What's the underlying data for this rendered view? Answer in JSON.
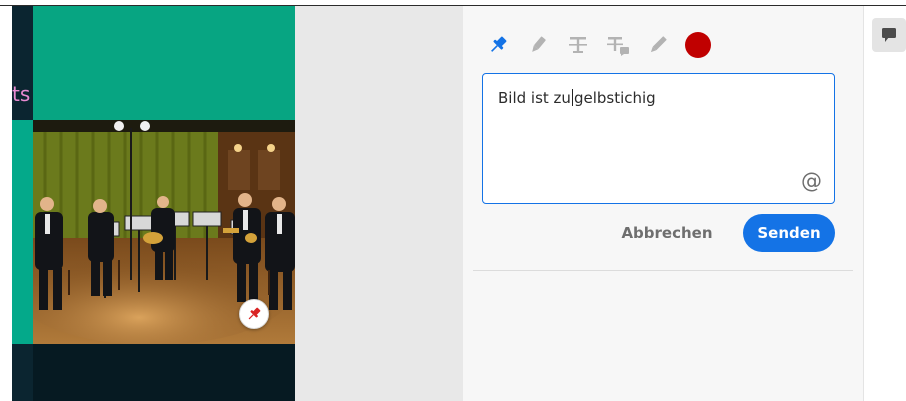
{
  "document": {
    "title_fragment": "ts",
    "photo_alt": "Blechbläserquintett"
  },
  "toolbar": {
    "tools": [
      "pin-icon",
      "highlight-icon",
      "strikethrough-icon",
      "replace-text-icon",
      "draw-icon"
    ],
    "active_tool": "pin-icon",
    "selected_color": "#c00000"
  },
  "comment": {
    "text_before_caret": "Bild ist zu",
    "text_after_caret": "gelbstichig",
    "mention_symbol": "@"
  },
  "actions": {
    "cancel_label": "Abbrechen",
    "send_label": "Senden"
  },
  "colors": {
    "accent": "#1473e6",
    "doc_green": "#07a582",
    "doc_dark": "#061a22"
  }
}
